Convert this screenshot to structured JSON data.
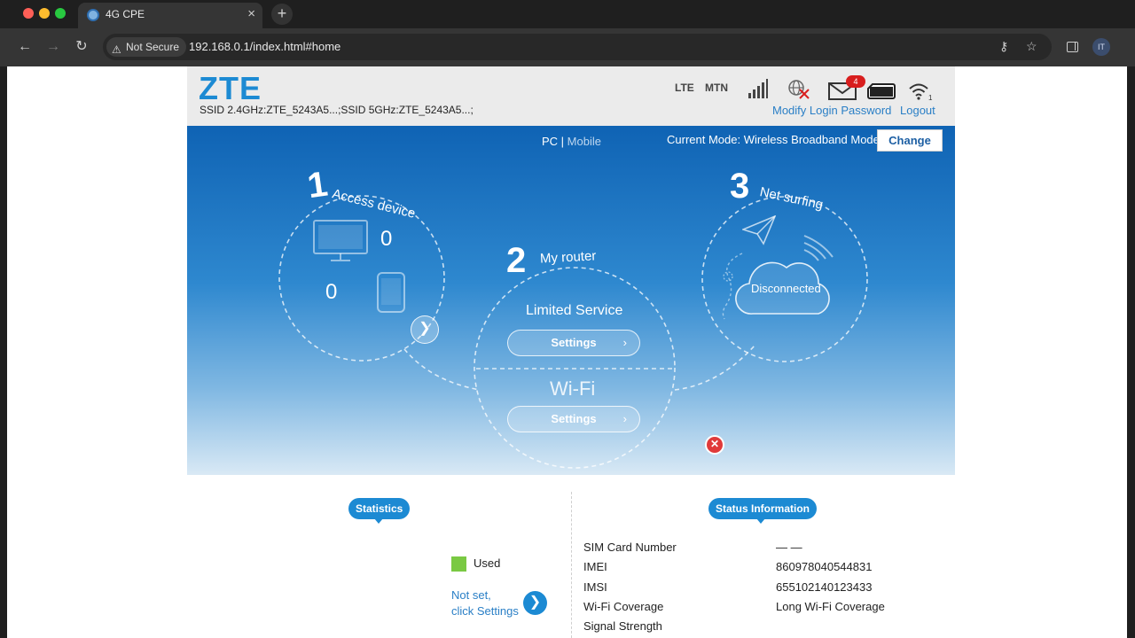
{
  "browser": {
    "tab_title": "4G CPE",
    "tab_close": "×",
    "new_tab": "+",
    "security_label": "Not Secure",
    "url": "192.168.0.1/index.html#home",
    "avatar_initials": "IT"
  },
  "header": {
    "logo": "ZTE",
    "ssid": "SSID 2.4GHz:ZTE_5243A5...;SSID 5GHz:ZTE_5243A5...;",
    "network_type": "LTE",
    "operator": "MTN",
    "unread_messages": "4",
    "modify_password_link": "Modify Login Password",
    "logout_link": "Logout"
  },
  "hero": {
    "view_pc": "PC",
    "view_separator": " | ",
    "view_mobile": "Mobile",
    "current_mode": "Current Mode: Wireless Broadband Mode",
    "change_button": "Change",
    "step1": {
      "number": "1",
      "label": "Access device",
      "pc_count": "0",
      "mobile_count": "0"
    },
    "step2": {
      "number": "2",
      "label": "My router",
      "status": "Limited Service",
      "settings_button": "Settings",
      "wifi_label": "Wi-Fi",
      "wifi_settings_button": "Settings"
    },
    "step3": {
      "number": "3",
      "label": "Net surfing",
      "status": "Disconnected"
    }
  },
  "statistics": {
    "title": "Statistics",
    "legend_used": "Used",
    "not_set_line1": "Not set,",
    "not_set_line2": "click Settings"
  },
  "status_info": {
    "title": "Status Information",
    "rows": [
      {
        "label": "SIM Card Number",
        "value": "— —"
      },
      {
        "label": "IMEI",
        "value": "860978040544831"
      },
      {
        "label": "IMSI",
        "value": "655102140123433"
      },
      {
        "label": "Wi-Fi Coverage",
        "value": "Long Wi-Fi Coverage"
      },
      {
        "label": "Signal Strength",
        "value": ""
      }
    ]
  },
  "colors": {
    "brand": "#1c8ad3",
    "hero_top": "#0f63b4",
    "alert": "#d81e1e",
    "used": "#7ac943"
  }
}
